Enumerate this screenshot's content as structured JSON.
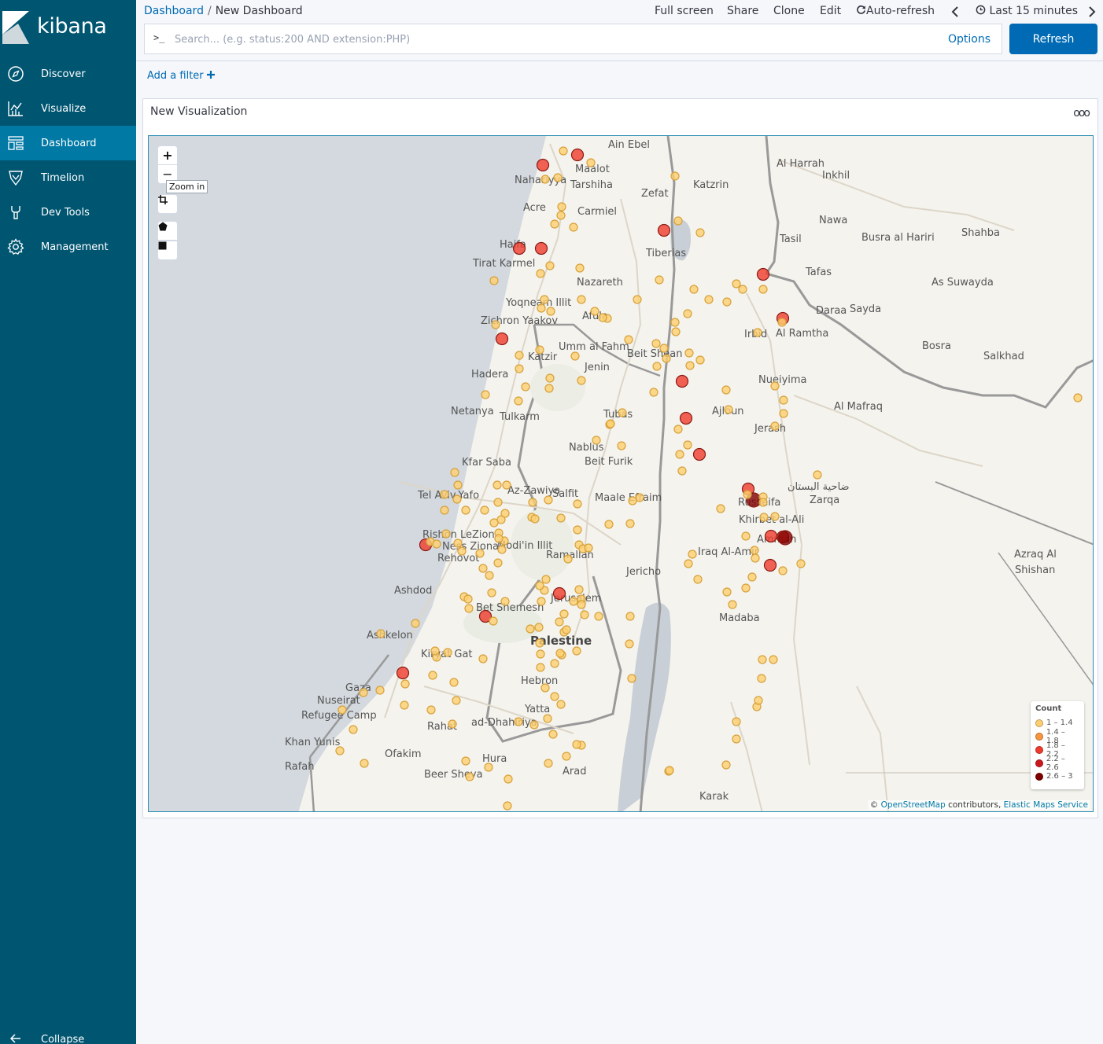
{
  "app": {
    "name": "kibana"
  },
  "sidebar": {
    "items": [
      {
        "label": "Discover",
        "icon": "compass-icon"
      },
      {
        "label": "Visualize",
        "icon": "visualize-icon"
      },
      {
        "label": "Dashboard",
        "icon": "dashboard-icon",
        "active": true
      },
      {
        "label": "Timelion",
        "icon": "timelion-icon"
      },
      {
        "label": "Dev Tools",
        "icon": "wrench-icon"
      },
      {
        "label": "Management",
        "icon": "gear-icon"
      }
    ],
    "collapse_label": "Collapse"
  },
  "breadcrumb": {
    "home": "Dashboard",
    "separator": "/",
    "current": "New Dashboard"
  },
  "top_actions": {
    "fullscreen": "Full screen",
    "share": "Share",
    "clone": "Clone",
    "edit": "Edit",
    "autorefresh": "Auto-refresh",
    "time_range": "Last 15 minutes"
  },
  "query": {
    "prompt": ">_",
    "placeholder": "Search... (e.g. status:200 AND extension:PHP)",
    "value": "",
    "options_label": "Options",
    "refresh_label": "Refresh"
  },
  "filters": {
    "add_label": "Add a filter"
  },
  "panel": {
    "title": "New Visualization",
    "menu": "ooo",
    "map": {
      "controls": {
        "zoom_in": "+",
        "zoom_out": "−",
        "zoom_tooltip": "Zoom in"
      },
      "legend": {
        "title": "Count",
        "ranges": [
          {
            "label": "1 – 1.4",
            "color": "#fecf71"
          },
          {
            "label": "1.4 – 1.8",
            "color": "#f9953f"
          },
          {
            "label": "1.8 – 2.2",
            "color": "#ef3b2c"
          },
          {
            "label": "2.2 – 2.6",
            "color": "#cb181d"
          },
          {
            "label": "2.6 – 3",
            "color": "#7f0000"
          }
        ]
      },
      "attribution": {
        "prefix": "© ",
        "osm": "OpenStreetMap",
        "contributors": " contributors, ",
        "ems": "Elastic Maps Service"
      },
      "place_labels": [
        "Ain Ebel",
        "Maalot",
        "Nahariyya",
        "Tarshiha",
        "Zefat",
        "Katzrin",
        "Al Harrah",
        "Inkhil",
        "Acre",
        "Carmiel",
        "Nawa",
        "Tasil",
        "Busra al Hariri",
        "Shahba",
        "Haifa",
        "Tiberias",
        "Tirat Karmel",
        "Nazareth",
        "Tafas",
        "As Suwayda",
        "Yoqneam Illit",
        "Afula",
        "Daraa",
        "Sayda",
        "Zichron Yaakov",
        "Irbid",
        "Al Ramtha",
        "Umm al Fahm",
        "Katzir",
        "Beit Shean",
        "Jenin",
        "Bosra",
        "Salkhad",
        "Hadera",
        "Nueiyima",
        "Netanya",
        "Tulkarm",
        "Tubas",
        "Ajloun",
        "Al Mafraq",
        "Jerash",
        "Nablus",
        "Beit Furik",
        "Kfar Saba",
        "ضاحية البستان",
        "Tel Aviv-Yafo",
        "Az-Zawiya",
        "Salfit",
        "Maale Efraim",
        "Russeifa",
        "Zarqa",
        "Khirbet al-Ali",
        "Rishon LeZion",
        "Ness Ziona",
        "Rehovot",
        "Modi'in Illit",
        "Ramallah",
        "Amman",
        "Iraq Al-Amir",
        "Azraq Al",
        "Shishan",
        "Jericho",
        "Ashdod",
        "Jerusalem",
        "Bet Shemesh",
        "Madaba",
        "Ashkelon",
        "Palestine",
        "Kiryat Gat",
        "Hebron",
        "Gaza",
        "Nuseirat",
        "Refugee Camp",
        "Yatta",
        "ad-Dhahiriya",
        "Rahat",
        "Khan Yunis",
        "Ofakim",
        "Hura",
        "Rafah",
        "Arad",
        "Beer Sheva",
        "Karak"
      ]
    }
  }
}
